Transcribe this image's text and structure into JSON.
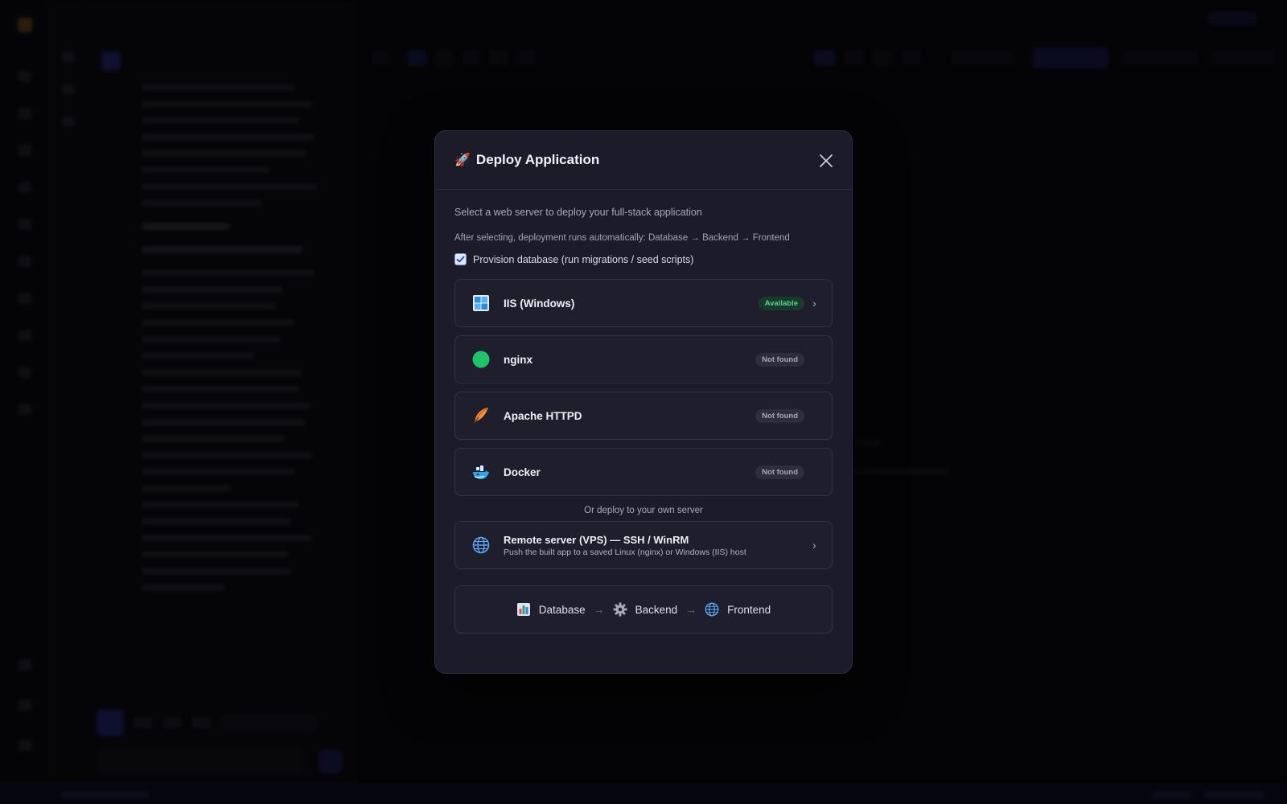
{
  "modal": {
    "title": "Deploy Application",
    "subtitle": "Select a web server to deploy your full-stack application",
    "note": "After selecting, deployment runs automatically: Database → Backend → Frontend",
    "provision_label": "Provision database (run migrations / seed scripts)",
    "provision_checked": true,
    "servers": [
      {
        "name": "IIS (Windows)",
        "status": "Available",
        "icon": "windows-icon"
      },
      {
        "name": "nginx",
        "status": "Not found",
        "icon": "nginx-icon"
      },
      {
        "name": "Apache HTTPD",
        "status": "Not found",
        "icon": "apache-feather-icon"
      },
      {
        "name": "Docker",
        "status": "Not found",
        "icon": "docker-whale-icon"
      }
    ],
    "or_text": "Or deploy to your own server",
    "remote": {
      "title": "Remote server (VPS) — SSH / WinRM",
      "description": "Push the built app to a saved Linux (nginx) or Windows (IIS) host"
    },
    "pipeline": [
      {
        "label": "Database",
        "icon": "database-icon"
      },
      {
        "label": "Backend",
        "icon": "gear-icon"
      },
      {
        "label": "Frontend",
        "icon": "globe-icon"
      }
    ]
  },
  "colors": {
    "available": "#58d389",
    "modal_bg": "#1b1b29",
    "accent": "#2a2a8a"
  }
}
